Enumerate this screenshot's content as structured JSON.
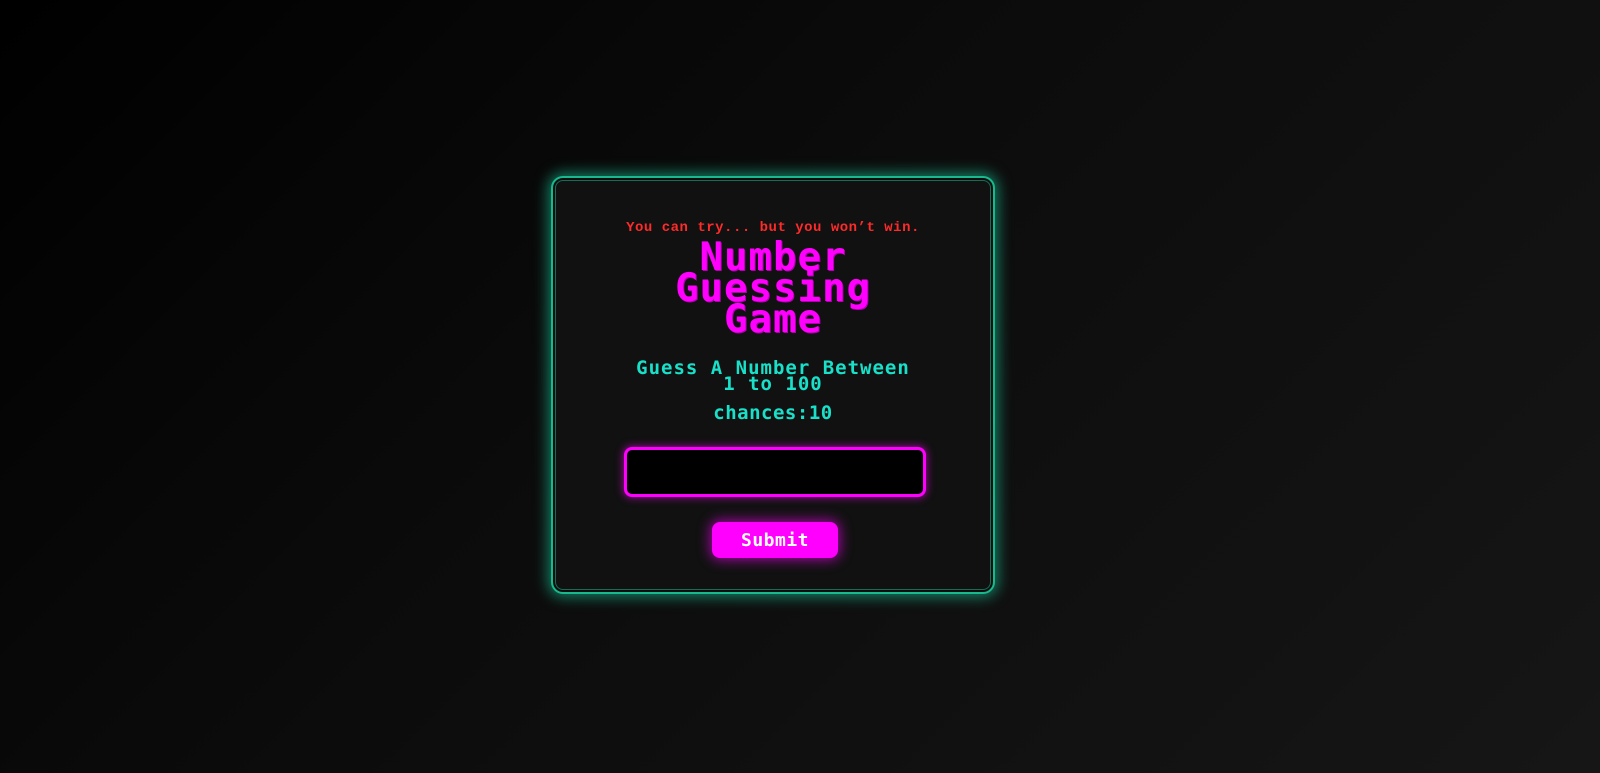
{
  "game": {
    "taunt": "You can try... but you won’t win.",
    "title_lines": [
      "Number",
      "Guessing",
      "Game"
    ],
    "instruction_lines": [
      "Guess A Number Between",
      "1 to 100"
    ],
    "chances_label": "chances:",
    "chances_value": "10",
    "guess_input": {
      "value": "",
      "placeholder": ""
    },
    "submit_label": "Submit"
  },
  "colors": {
    "background": "#0c0c0c",
    "card": "#111111",
    "card_border": "#19b98f",
    "taunt": "#ff2a2a",
    "title": "#ff00ff",
    "instruction": "#19e0c8",
    "accent": "#ff00ff"
  }
}
